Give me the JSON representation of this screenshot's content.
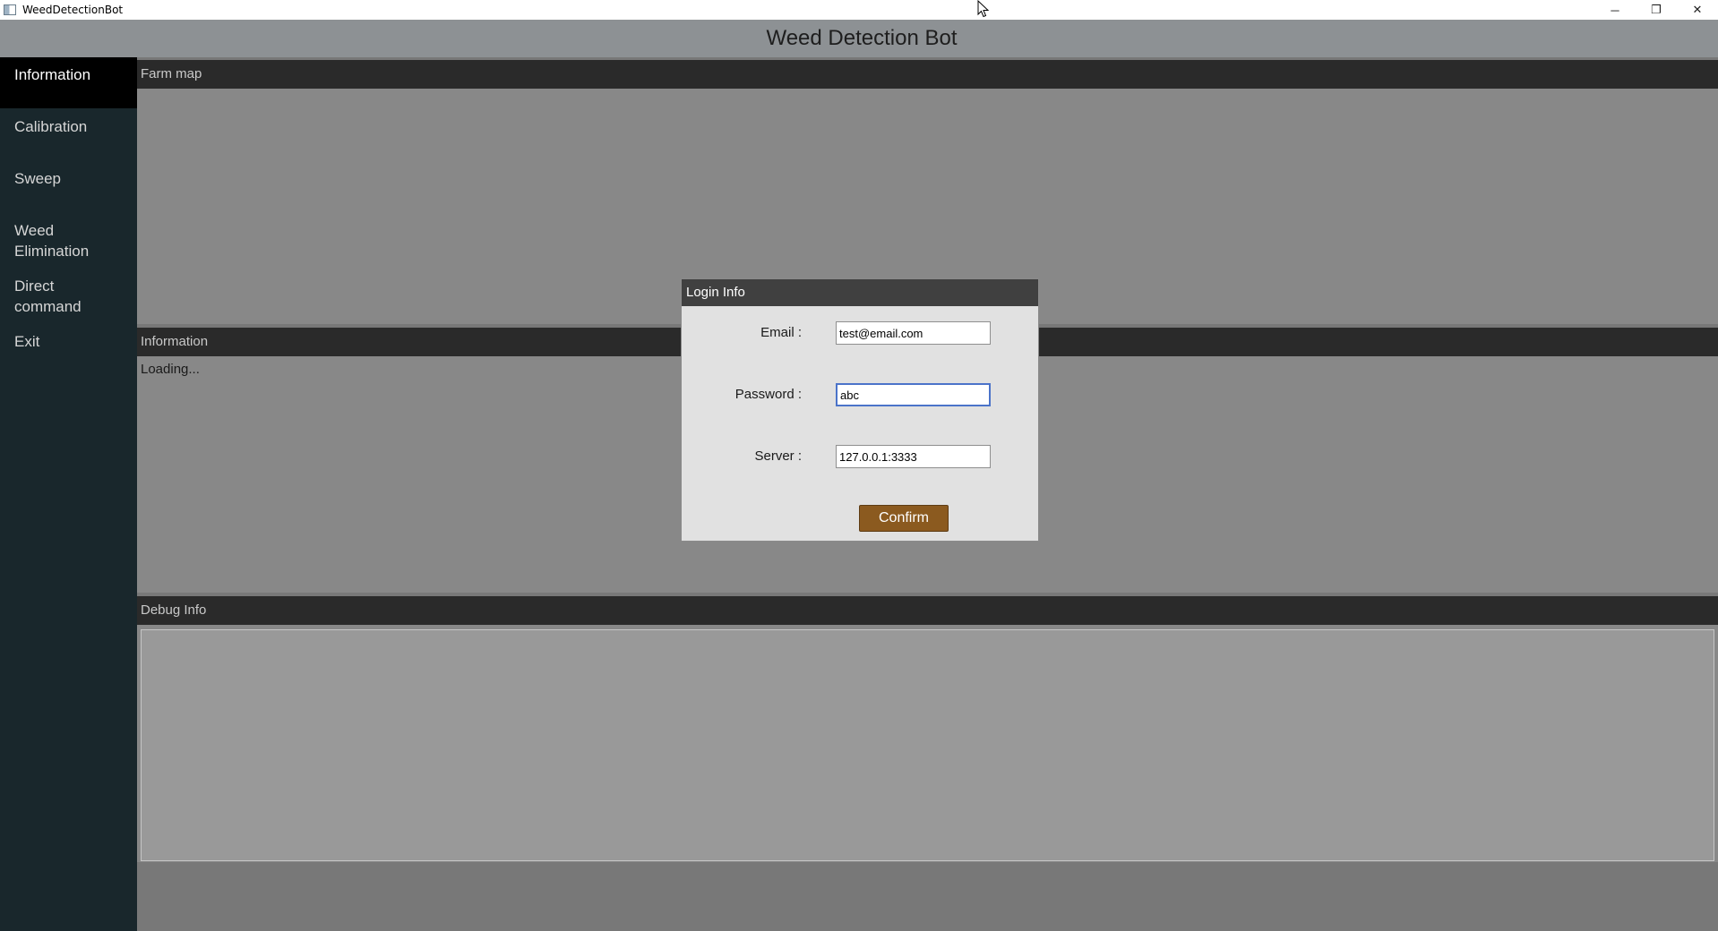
{
  "window": {
    "title": "WeedDetectionBot",
    "controls": {
      "minimize": "─",
      "restore": "❐",
      "close": "✕"
    }
  },
  "header": {
    "title": "Weed Detection Bot"
  },
  "sidebar": {
    "items": [
      {
        "label": "Information"
      },
      {
        "label": "Calibration"
      },
      {
        "label": "Sweep"
      },
      {
        "label": "Weed Elimination"
      },
      {
        "label": "Direct command"
      },
      {
        "label": "Exit"
      }
    ],
    "active": "Information"
  },
  "panels": {
    "farm_map": {
      "title": "Farm map"
    },
    "information": {
      "title": "Information",
      "status": "Loading..."
    },
    "debug": {
      "title": "Debug Info"
    }
  },
  "login_dialog": {
    "title": "Login Info",
    "email_label": "Email :",
    "email_value": "test@email.com",
    "password_label": "Password :",
    "password_value": "abc",
    "server_label": "Server :",
    "server_value": "127.0.0.1:3333",
    "confirm_label": "Confirm"
  },
  "colors": {
    "sidebar_bg": "#19272c",
    "panel_header_bg": "#2a2a2a",
    "confirm_button": "#8b5a1f",
    "focus_border": "#4b73c9"
  }
}
